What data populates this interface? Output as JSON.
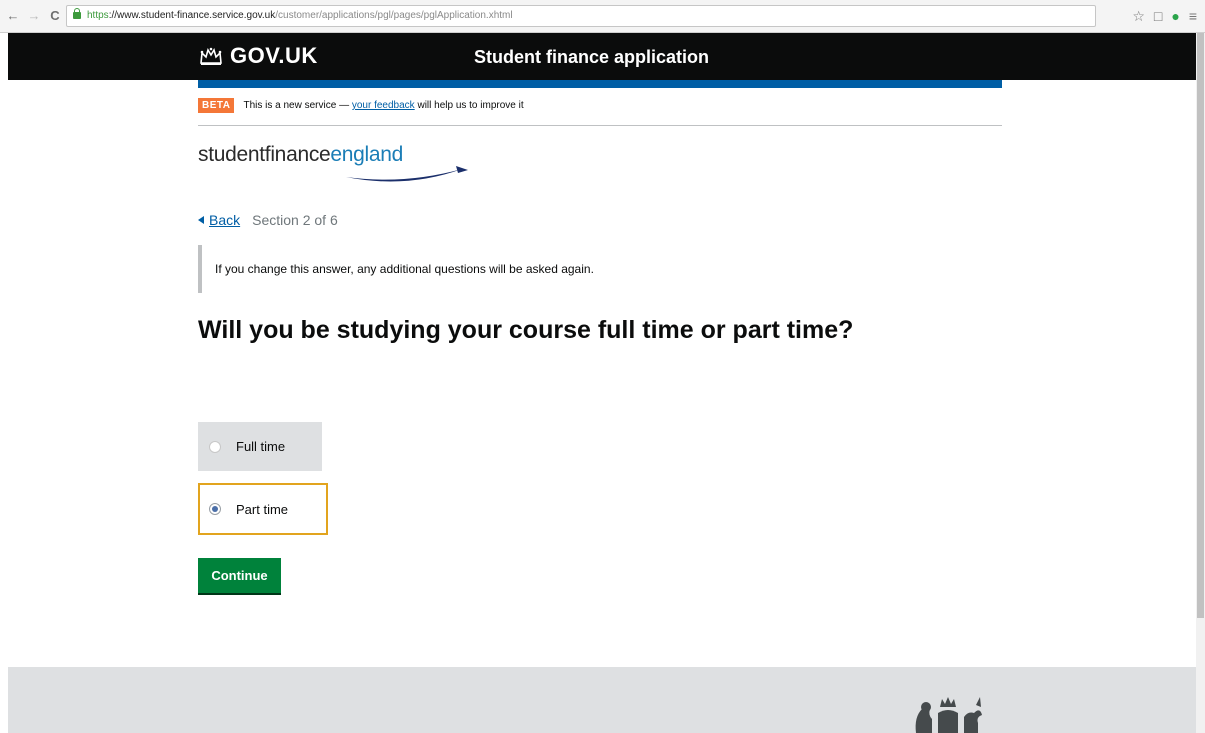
{
  "browser": {
    "url_https": "https",
    "url_host": "://www.student-finance.service.gov.uk",
    "url_path": "/customer/applications/pgl/pages/pglApplication.xhtml"
  },
  "header": {
    "logo_text": "GOV.UK",
    "service_name": "Student finance application"
  },
  "beta": {
    "tag": "BETA",
    "text_before": "This is a new service — ",
    "link": "your feedback",
    "text_after": " will help us to improve it"
  },
  "brand": {
    "word1": "studentfinance",
    "word2": "england"
  },
  "nav": {
    "back_label": "Back",
    "section_text": "Section 2 of 6"
  },
  "inset_text": "If you change this answer, any additional questions will be asked again.",
  "question": "Will you be studying your course full time or part time?",
  "options": [
    {
      "label": "Full time",
      "selected": false
    },
    {
      "label": "Part time",
      "selected": true
    }
  ],
  "continue_label": "Continue",
  "colors": {
    "header_bg": "#0b0c0c",
    "brand_blue": "#005ea5",
    "beta_orange": "#f47738",
    "button_green": "#00823b",
    "focus_yellow": "#e2a41e"
  }
}
